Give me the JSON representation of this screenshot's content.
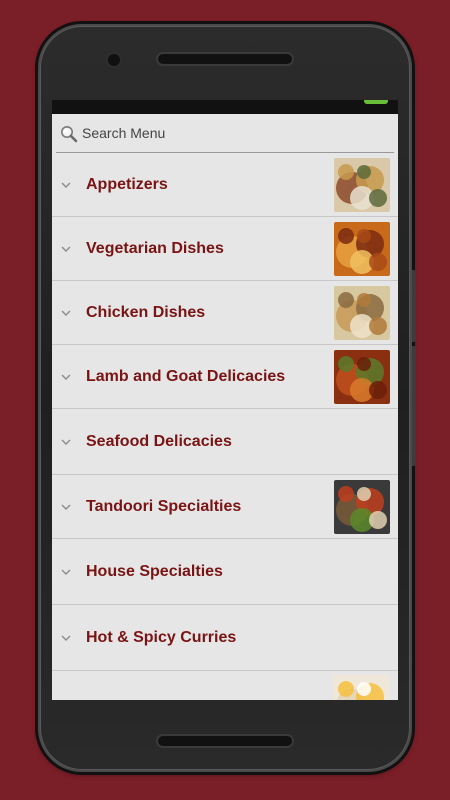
{
  "search": {
    "placeholder": "Search Menu",
    "icon": "search-icon"
  },
  "menu": {
    "items": [
      {
        "label": "Appetizers",
        "has_image": true,
        "image": "appetizer-photo"
      },
      {
        "label": "Vegetarian Dishes",
        "has_image": true,
        "image": "vegetarian-photo"
      },
      {
        "label": "Chicken Dishes",
        "has_image": true,
        "image": "chicken-photo"
      },
      {
        "label": "Lamb and Goat Delicacies",
        "has_image": true,
        "image": "lamb-photo"
      },
      {
        "label": "Seafood Delicacies",
        "has_image": false
      },
      {
        "label": "Tandoori Specialties",
        "has_image": true,
        "image": "tandoori-photo"
      },
      {
        "label": "House Specialties",
        "has_image": false
      },
      {
        "label": "Hot & Spicy Curries",
        "has_image": false
      },
      {
        "label": "",
        "has_image": true,
        "image": "rice-photo"
      }
    ]
  },
  "colors": {
    "background": "#7a1e27",
    "item_text": "#7a1414",
    "screen_bg": "#e6e6e6",
    "battery": "#6abf3a"
  }
}
